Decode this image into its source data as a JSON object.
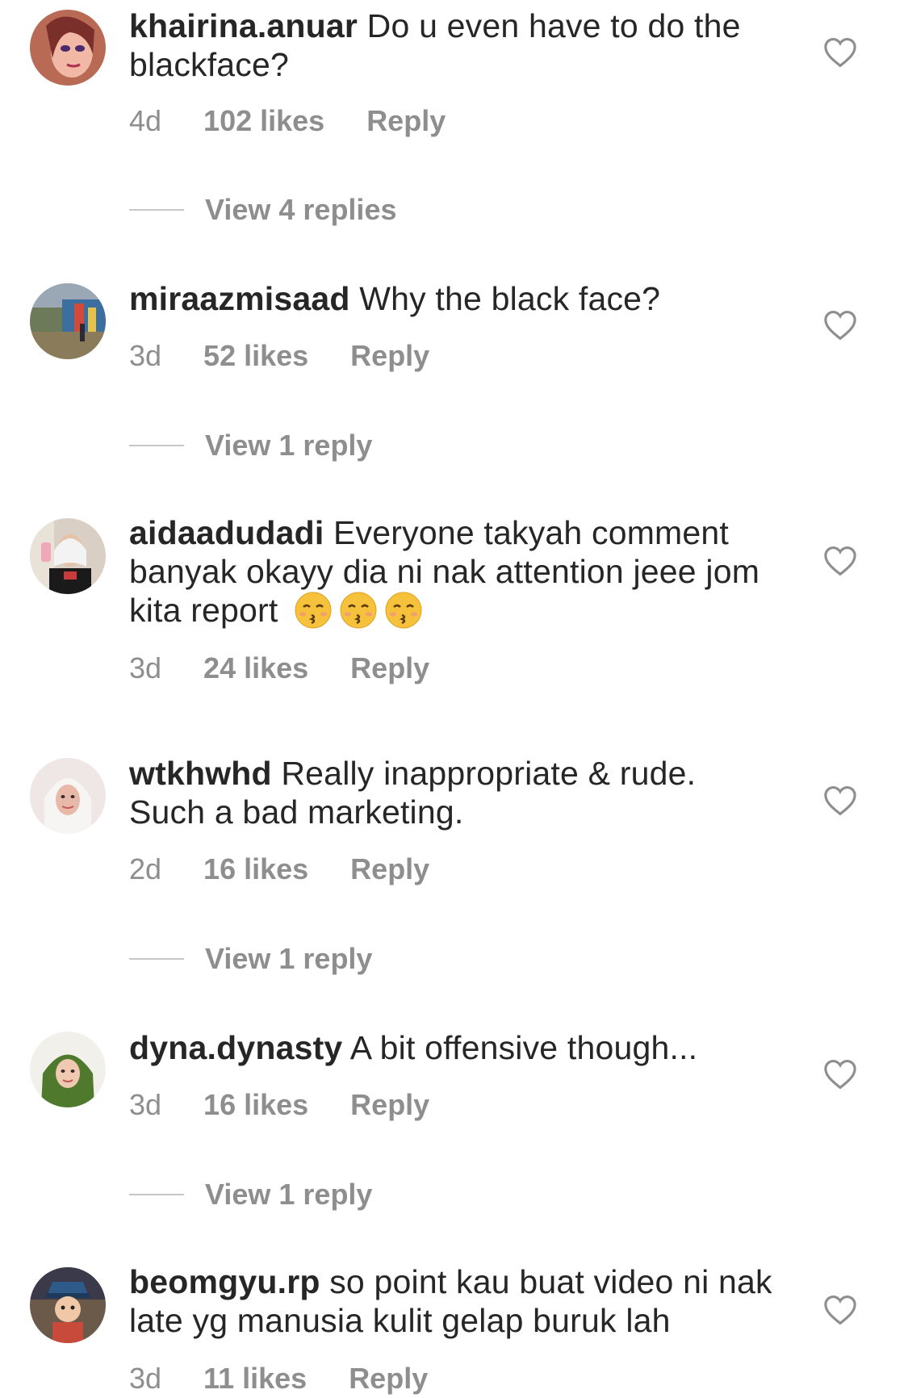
{
  "comments": [
    {
      "username": "khairina.anuar",
      "text": "Do u even have to do the blackface?",
      "time": "4d",
      "likes": "102 likes",
      "reply_label": "Reply",
      "view_replies": "View 4 replies"
    },
    {
      "username": "miraazmisaad",
      "text": "Why the black face?",
      "time": "3d",
      "likes": "52 likes",
      "reply_label": "Reply",
      "view_replies": "View 1 reply"
    },
    {
      "username": "aidaadudadi",
      "text": "Everyone takyah comment banyak okayy dia ni nak attention jeee jom kita report",
      "emoji": "kissing-face-closed-eyes",
      "time": "3d",
      "likes": "24 likes",
      "reply_label": "Reply"
    },
    {
      "username": "wtkhwhd",
      "text": "Really inappropriate & rude. Such a bad marketing.",
      "time": "2d",
      "likes": "16 likes",
      "reply_label": "Reply",
      "view_replies": "View 1 reply"
    },
    {
      "username": "dyna.dynasty",
      "text": "A bit offensive though...",
      "time": "3d",
      "likes": "16 likes",
      "reply_label": "Reply",
      "view_replies": "View 1 reply"
    },
    {
      "username": "beomgyu.rp",
      "text": "so point kau buat video ni nak late yg manusia kulit gelap buruk lah",
      "time": "3d",
      "likes": "11 likes",
      "reply_label": "Reply"
    }
  ],
  "icons": {
    "like": "heart-outline-icon"
  },
  "colors": {
    "text": "#262626",
    "secondary": "#8e8e8e",
    "divider": "#c7c7c7"
  }
}
